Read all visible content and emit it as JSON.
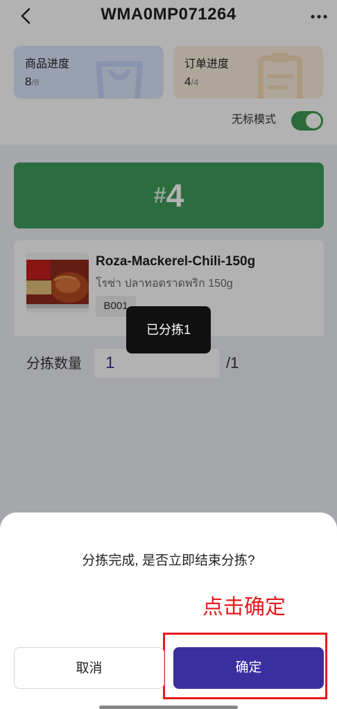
{
  "header": {
    "title": "WMA0MP071264",
    "back_icon": "chevron-left-icon",
    "more_icon": "more-dots-icon"
  },
  "progress": {
    "goods": {
      "label": "商品进度",
      "done": "8",
      "total": "/8"
    },
    "orders": {
      "label": "订单进度",
      "done": "4",
      "total": "/4"
    }
  },
  "no_label_mode": {
    "label": "无标模式",
    "enabled": true
  },
  "slot": {
    "hash": "#",
    "number": "4"
  },
  "product": {
    "name": "Roza-Mackerel-Chili-150g",
    "thai_name": "โรซ่า ปลาทอดราดพริก 150g",
    "location_code": "B001",
    "qty_label": "分拣数量",
    "qty_value": "1",
    "qty_total": "/1"
  },
  "toast": "已分拣1",
  "dialog": {
    "question": "分拣完成, 是否立即结束分拣?",
    "cancel_label": "取消",
    "confirm_label": "确定"
  },
  "annotation": {
    "text": "点击确定",
    "color": "#e8191b"
  },
  "colors": {
    "accent": "#3b2fa0",
    "green": "#3f9d5b"
  }
}
